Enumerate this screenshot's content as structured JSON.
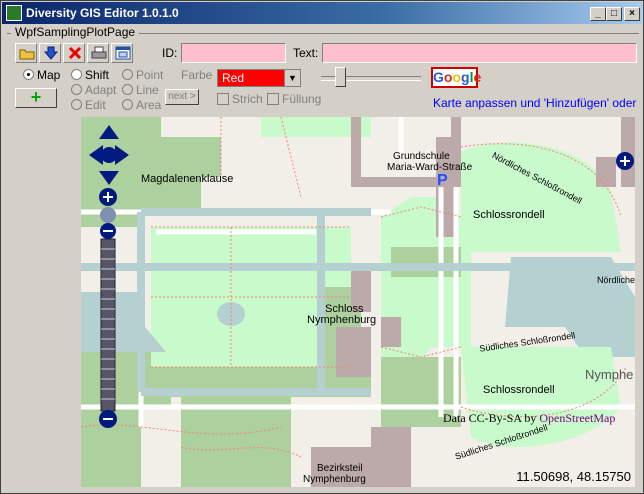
{
  "window": {
    "title": "Diversity GIS Editor 1.0.1.0",
    "minimize": "_",
    "maximize": "□",
    "close": "×"
  },
  "tab": {
    "label": "WpfSamplingPlotPage"
  },
  "toolbar": {
    "icons": [
      "open-folder-icon",
      "download-icon",
      "delete-icon",
      "print-icon",
      "window-icon"
    ]
  },
  "fields": {
    "id_label": "ID:",
    "id_value": "",
    "text_label": "Text:",
    "text_value": ""
  },
  "modes": {
    "map": "Map",
    "shift": "Shift",
    "adapt": "Adapt",
    "edit": "Edit",
    "point": "Point",
    "line": "Line",
    "area": "Area",
    "selected": "Map"
  },
  "add_button": "+",
  "next_button": "next >",
  "color": {
    "label": "Farbe",
    "value": "Red",
    "swatch": "#ff0000"
  },
  "strich": "Strich",
  "fuellung": "Füllung",
  "google": "Google",
  "hint": "Karte anpassen und 'Hinzufügen' oder 'S",
  "map": {
    "labels": {
      "magdalenenklause": "Magdalenenklause",
      "grundschule_1": "Grundschule",
      "grundschule_2": "Maria-Ward-Straße",
      "schlossrondell_top": "Schlossrondell",
      "schloss_1": "Schloss",
      "schloss_2": "Nymphenburg",
      "noerdliches_1": "Nördliches Schloßrondell",
      "noerdliches_2": "Nördliche",
      "suedliches_1": "Südliches Schloßrondell",
      "suedliches_2": "Südliches Schloßrondell",
      "schlossrondell_bottom": "Schlossrondell",
      "nymphe": "Nymphe",
      "bezirksteil_1": "Bezirksteil",
      "bezirksteil_2": "Nymphenburg",
      "parking": "P"
    },
    "attribution_pre": "Data CC-By-SA by ",
    "attribution_osm": "OpenStreetMap",
    "coordinates": "11.50698, 48.15750",
    "colors": {
      "park": "#c8facc",
      "forest": "#add19e",
      "building": "#bca9a9",
      "water": "#b5d0d0",
      "land": "#f2efe9",
      "path": "#fa8072"
    }
  }
}
